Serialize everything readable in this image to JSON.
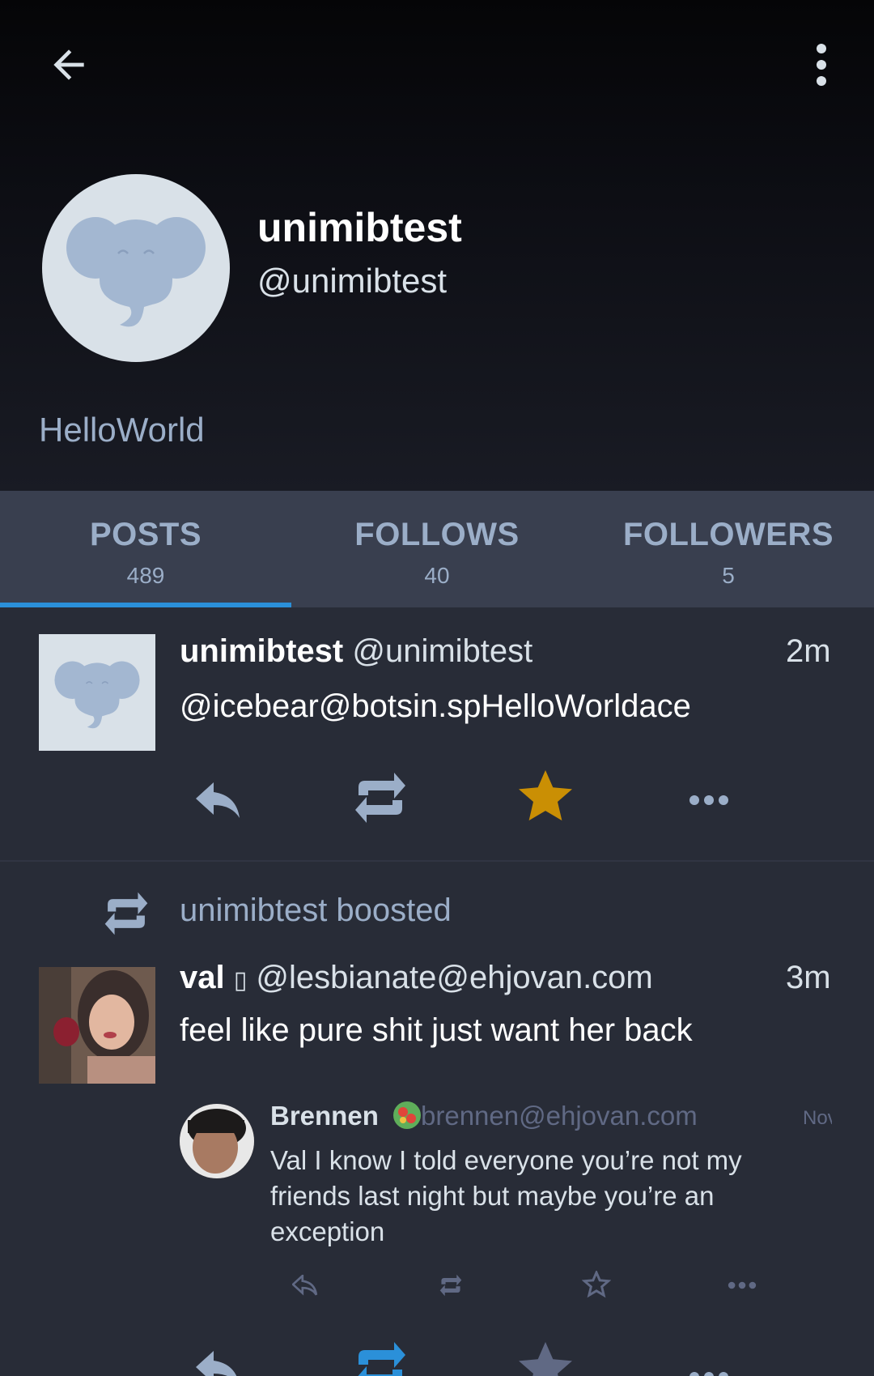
{
  "profile": {
    "display_name": "unimibtest",
    "handle": "@unimibtest",
    "bio": "HelloWorld"
  },
  "tabs": [
    {
      "label": "POSTS",
      "count": "489",
      "active": true
    },
    {
      "label": "FOLLOWS",
      "count": "40",
      "active": false
    },
    {
      "label": "FOLLOWERS",
      "count": "5",
      "active": false
    }
  ],
  "statuses": [
    {
      "display_name": "unimibtest",
      "acct": "@unimibtest",
      "time": "2m",
      "content": "@icebear@botsin.spHelloWorldace",
      "favourited": true
    },
    {
      "boost_label": "unimibtest boosted",
      "display_name": "val",
      "name_emoji": "▯",
      "acct": "@lesbianate@ehjovan.com",
      "time": "3m",
      "content": "feel like pure shit just want her back",
      "quote": {
        "display_name": "Brennen",
        "acct": "brennen@ehjovan.com",
        "time": "Nov",
        "content": "Val I know I told everyone you’re not my friends last night but maybe you’re an exception"
      }
    }
  ],
  "colors": {
    "accent": "#2b90d9",
    "favourite": "#ca8f04",
    "muted": "#9baec8"
  }
}
